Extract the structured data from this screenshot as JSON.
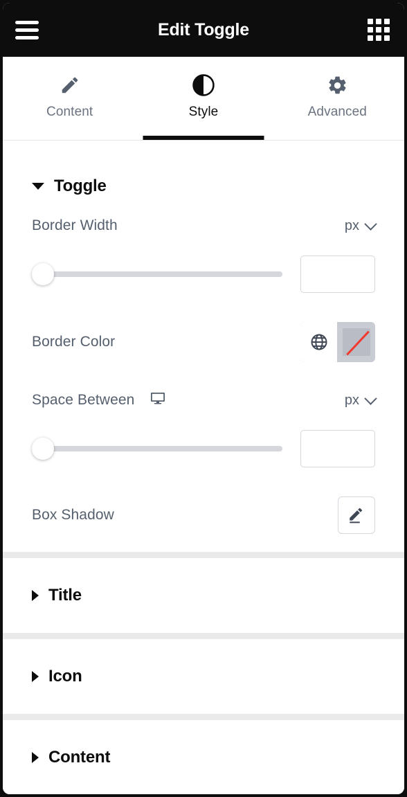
{
  "header": {
    "title": "Edit Toggle",
    "menu_icon": "hamburger-menu-icon",
    "apps_icon": "apps-grid-icon"
  },
  "tabs": [
    {
      "label": "Content",
      "icon": "pencil-icon",
      "active": false
    },
    {
      "label": "Style",
      "icon": "contrast-icon",
      "active": true
    },
    {
      "label": "Advanced",
      "icon": "gear-icon",
      "active": false
    }
  ],
  "sections": {
    "toggle": {
      "title": "Toggle",
      "expanded": true,
      "caret": "caret-down-icon"
    },
    "collapsed": [
      {
        "title": "Title",
        "caret": "caret-right-icon"
      },
      {
        "title": "Icon",
        "caret": "caret-right-icon"
      },
      {
        "title": "Content",
        "caret": "caret-right-icon"
      }
    ]
  },
  "controls": {
    "border_width": {
      "label": "Border Width",
      "unit": "px",
      "unit_caret": "chevron-down-icon",
      "slider_value": 0,
      "slider_min": 0,
      "slider_max": 100,
      "input_value": "",
      "input_placeholder": ""
    },
    "border_color": {
      "label": "Border Color",
      "globe_icon": "globe-icon",
      "swatch": "no-color-swatch",
      "swatch_slash_color": "#f2392f",
      "swatch_color": "#b9bcc4"
    },
    "space_between": {
      "label": "Space Between",
      "responsive_icon": "desktop-monitor-icon",
      "unit": "px",
      "unit_caret": "chevron-down-icon",
      "slider_value": 0,
      "slider_min": 0,
      "slider_max": 100,
      "input_value": "",
      "input_placeholder": ""
    },
    "box_shadow": {
      "label": "Box Shadow",
      "edit_icon": "pencil-edit-icon"
    }
  },
  "colors": {
    "header_bg": "#0d0d0d",
    "panel_bg": "#ffffff",
    "label_text": "#555f6d",
    "tab_inactive": "#6b7280",
    "accent": "#0d0d0d",
    "track": "#d5d7dd",
    "divider": "#eaeaea"
  }
}
